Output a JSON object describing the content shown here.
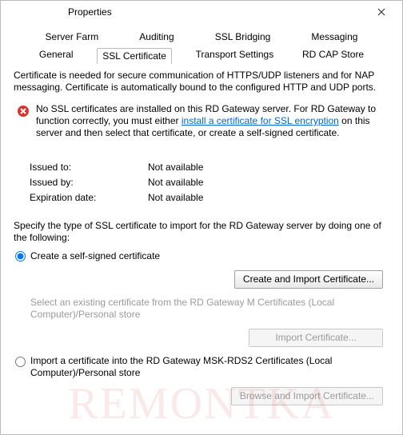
{
  "window": {
    "title": "Properties"
  },
  "tabs": {
    "row1": [
      "Server Farm",
      "Auditing",
      "SSL Bridging",
      "Messaging"
    ],
    "row2": [
      "General",
      "SSL Certificate",
      "Transport Settings",
      "RD CAP Store"
    ],
    "selected": "SSL Certificate"
  },
  "intro": "Certificate is needed for secure communication of HTTPS/UDP listeners and for NAP messaging. Certificate is automatically bound to the configured HTTP and UDP ports.",
  "warning": {
    "pre": "No SSL certificates are installed on this RD Gateway server. For RD Gateway to function correctly, you must either ",
    "link": "install a certificate for SSL encryption",
    "post": " on this server and then select that certificate, or create a self-signed certificate."
  },
  "details": {
    "issued_to_label": "Issued to:",
    "issued_to_value": "Not available",
    "issued_by_label": "Issued by:",
    "issued_by_value": "Not available",
    "expiration_label": "Expiration date:",
    "expiration_value": "Not available"
  },
  "specify": "Specify the type of SSL certificate to import for the RD Gateway server by doing one of the following:",
  "options": {
    "create": {
      "label": "Create a self-signed certificate",
      "button": "Create and Import Certificate..."
    },
    "select_existing": {
      "label": "Select an existing certificate from the RD Gateway M Certificates (Local Computer)/Personal store",
      "button": "Import Certificate..."
    },
    "import_into": {
      "label": "Import a certificate into the RD Gateway MSK-RDS2 Certificates (Local Computer)/Personal store",
      "button": "Browse and Import Certificate..."
    }
  },
  "watermark": "REMONTKA"
}
